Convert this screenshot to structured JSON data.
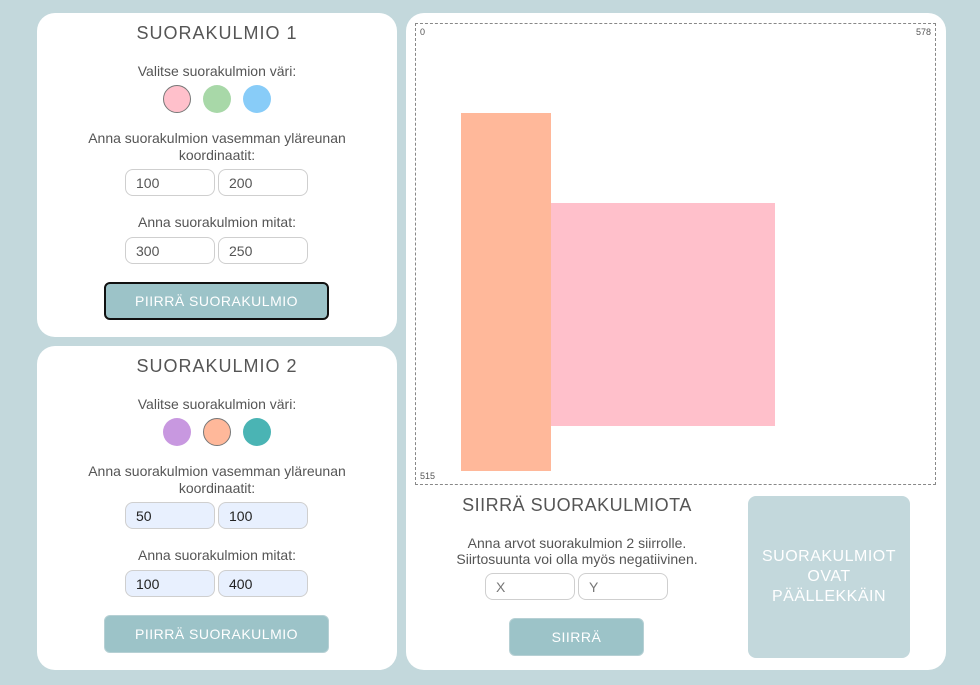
{
  "rect1": {
    "title": "SUORAKULMIO 1",
    "color_label": "Valitse suorakulmion väri:",
    "colors": [
      {
        "name": "pink",
        "hex": "#ffc0cb"
      },
      {
        "name": "green",
        "hex": "#a8d8a8"
      },
      {
        "name": "blue",
        "hex": "#88ccf8"
      }
    ],
    "selected_color": "pink",
    "coord_label": "Anna suorakulmion vasemman yläreunan koordinaatit:",
    "x_value": "100",
    "y_value": "200",
    "size_label": "Anna suorakulmion mitat:",
    "width_value": "300",
    "height_value": "250",
    "draw_label": "PIIRRÄ SUORAKULMIO"
  },
  "rect2": {
    "title": "SUORAKULMIO 2",
    "color_label": "Valitse suorakulmion väri:",
    "colors": [
      {
        "name": "purple",
        "hex": "#c898e0"
      },
      {
        "name": "peach",
        "hex": "#ffb89a"
      },
      {
        "name": "teal",
        "hex": "#4ab4b4"
      }
    ],
    "selected_color": "peach",
    "coord_label": "Anna suorakulmion vasemman yläreunan koordinaatit:",
    "x_value": "50",
    "y_value": "100",
    "size_label": "Anna suorakulmion mitat:",
    "width_value": "100",
    "height_value": "400",
    "draw_label": "PIIRRÄ SUORAKULMIO"
  },
  "canvas": {
    "top_left_label": "0",
    "top_right_label": "578",
    "bottom_left_label": "515",
    "width_units": 578,
    "height_units": 515
  },
  "move": {
    "title": "SIIRRÄ SUORAKULMIOTA",
    "instructions_line1": "Anna arvot suorakulmion 2 siirrolle.",
    "instructions_line2": "Siirtosuunta voi olla myös negatiivinen.",
    "x_placeholder": "X",
    "y_placeholder": "Y",
    "button_label": "SIIRRÄ"
  },
  "overlap_status": "SUORAKULMIOT OVAT PÄÄLLEKKÄIN"
}
